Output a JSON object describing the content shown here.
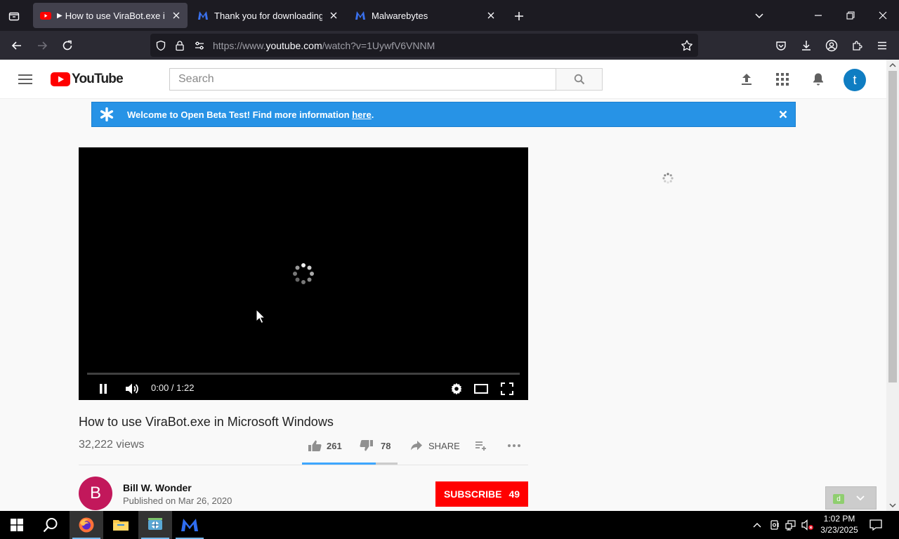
{
  "browser": {
    "tabs": [
      {
        "title": "How to use ViraBot.exe in M",
        "playing": "▶",
        "active": true
      },
      {
        "title": "Thank you for downloading Ma",
        "active": false
      },
      {
        "title": "Malwarebytes",
        "active": false
      }
    ],
    "url": {
      "scheme": "https://www.",
      "host": "youtube.com",
      "path": "/watch?v=1UywfV6VNNM"
    }
  },
  "youtube": {
    "logo_text": "YouTube",
    "search_placeholder": "Search",
    "avatar_letter": "t",
    "banner": {
      "text": "Welcome to Open Beta Test! Find more information ",
      "link": "here",
      "suffix": "."
    },
    "player": {
      "time": "0:00 / 1:22",
      "progress": 0,
      "state": "loading"
    },
    "video": {
      "title": "How to use ViraBot.exe in Microsoft Windows",
      "views": "32,222 views",
      "likes": "261",
      "dislikes": "78",
      "share_label": "SHARE",
      "like_ratio": 0.77
    },
    "owner": {
      "avatar_letter": "B",
      "name": "Bill W. Wonder",
      "published": "Published on Mar 26, 2020",
      "subscribe_label": "SUBSCRIBE",
      "subscriber_count": "49"
    },
    "widget_badge": "d"
  },
  "taskbar": {
    "time": "1:02 PM",
    "date": "3/23/2025"
  },
  "colors": {
    "tab_bar": "#1c1b22",
    "nav_bar": "#2b2a33",
    "youtube_red": "#ff0000",
    "banner_blue": "#2793e6",
    "owner_avatar": "#c2185b",
    "user_avatar": "#0f7dc2"
  }
}
